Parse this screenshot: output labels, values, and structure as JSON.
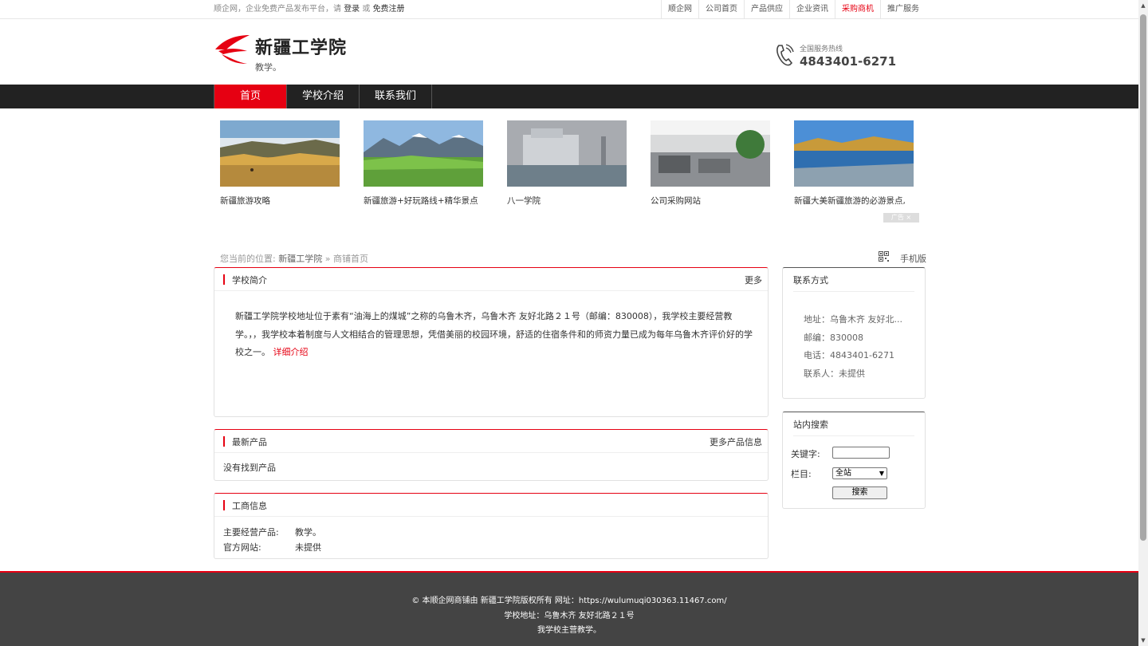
{
  "topbar": {
    "intro": "顺企网，企业免费产品发布平台，请",
    "login": "登录",
    "or": "或",
    "register": "免费注册",
    "links": [
      "顺企网",
      "公司首页",
      "产品供应",
      "企业资讯",
      "采购商机",
      "推广服务"
    ],
    "active_link_index": 4
  },
  "header": {
    "title": "新疆工学院",
    "subtitle": "教学。",
    "hotline_label": "全国服务热线",
    "hotline_number": "4843401-6271"
  },
  "nav": {
    "items": [
      "首页",
      "学校介绍",
      "联系我们"
    ],
    "active_index": 0
  },
  "ads": {
    "items": [
      {
        "caption": "新疆旅游攻略"
      },
      {
        "caption": "新疆旅游+好玩路线+精华景点"
      },
      {
        "caption": "八一学院"
      },
      {
        "caption": "公司采购网站"
      },
      {
        "caption": "新疆大美新疆旅游的必游景点,"
      }
    ],
    "badge": "广告"
  },
  "breadcrumb": {
    "prefix": "您当前的位置:",
    "school": "新疆工学院",
    "sep": "»",
    "current": "商铺首页",
    "mobile": "手机版"
  },
  "intro_panel": {
    "title": "学校简介",
    "more": "更多",
    "text": "新疆工学院学校地址位于素有“油海上的煤城”之称的乌鲁木齐，乌鲁木齐 友好北路２１号（邮编：830008），我学校主要经营教学。，，我学校本着制度与人文相结合的管理思想，凭借美丽的校园环境，舒适的住宿条件和的师资力量已成为每年乌鲁木齐评价好的学校之一。",
    "detail_link": "详细介绍"
  },
  "products_panel": {
    "title": "最新产品",
    "more": "更多产品信息",
    "empty_text": "没有找到产品"
  },
  "business_panel": {
    "title": "工商信息",
    "rows": [
      {
        "key": "主要经营产品:",
        "value": "教学。"
      },
      {
        "key": "官方网站:",
        "value": "未提供"
      }
    ]
  },
  "contact_panel": {
    "title": "联系方式",
    "address": "地址：乌鲁木齐 友好北...",
    "postcode": "邮编：830008",
    "phone": "电话：4843401-6271",
    "contact": "联系人：未提供"
  },
  "search_panel": {
    "title": "站内搜索",
    "keyword_label": "关键字:",
    "keyword_value": "",
    "category_label": "栏目:",
    "category_value": "全站",
    "button": "搜索"
  },
  "footer": {
    "line1": "© 本顺企网商铺由   新疆工学院版权所有 网址：https://wulumuqi030363.11467.com/",
    "line2": "学校地址：乌鲁木齐 友好北路２１号",
    "line3": "我学校主营教学。"
  },
  "colors": {
    "accent": "#e60012",
    "nav_bg": "#222222",
    "footer_bg": "#444444"
  }
}
